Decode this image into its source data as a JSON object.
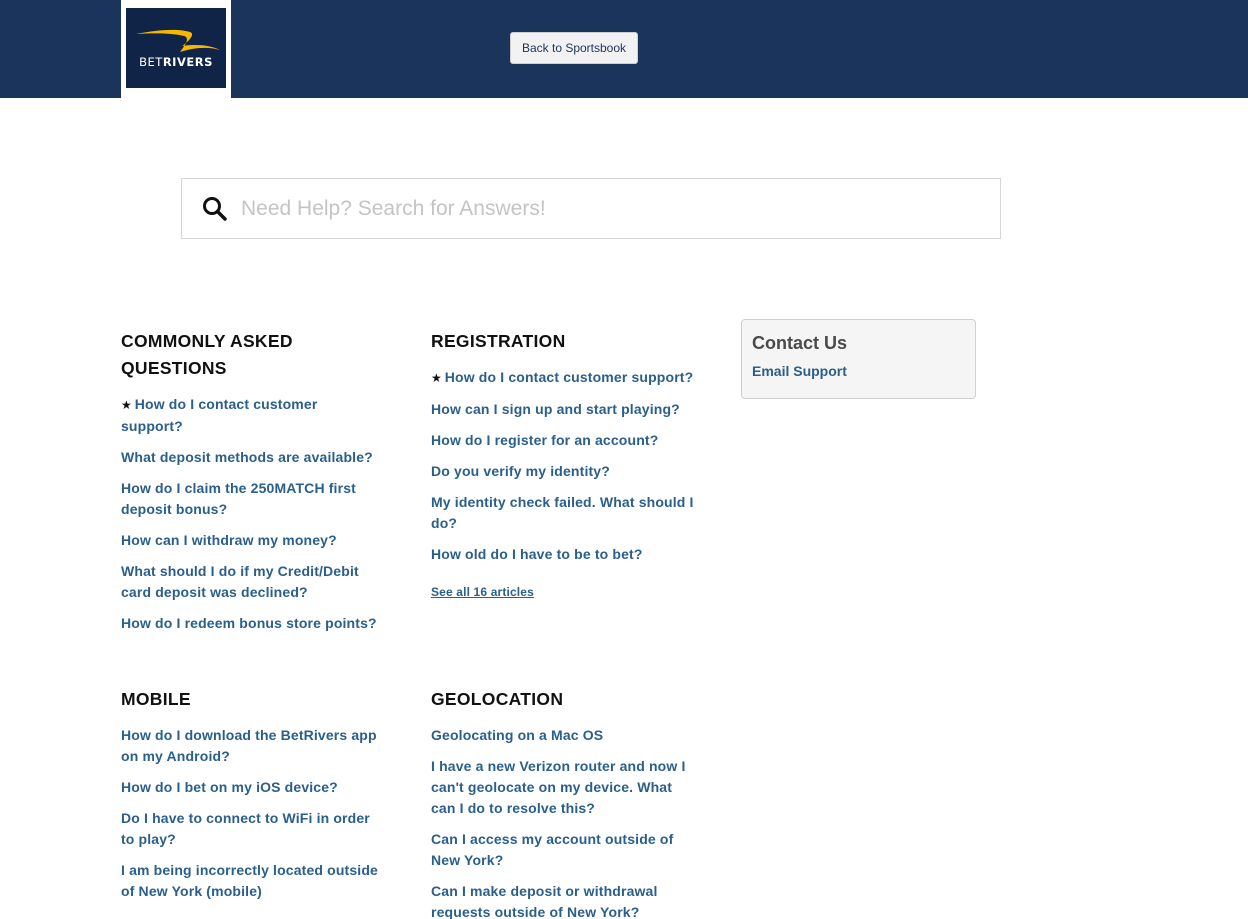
{
  "header": {
    "logo_prefix": "BET",
    "logo_suffix": "RIVERS",
    "back_button": "Back to Sportsbook"
  },
  "search": {
    "placeholder": "Need Help? Search for Answers!"
  },
  "sections": {
    "faq": {
      "title": "COMMONLY ASKED QUESTIONS",
      "items": [
        "How do I contact customer support?",
        "What deposit methods are available?",
        "How do I claim the 250MATCH first deposit bonus?",
        "How can I withdraw my money?",
        "What should I do if my Credit/Debit card deposit was declined?",
        "How do I redeem bonus store points?"
      ]
    },
    "registration": {
      "title": "REGISTRATION",
      "items": [
        "How do I contact customer support?",
        "How can I sign up and start playing?",
        "How do I register for an account?",
        "Do you verify my identity?",
        "My identity check failed. What should I do?",
        "How old do I have to be to bet?"
      ],
      "see_all": "See all 16 articles"
    },
    "mobile": {
      "title": "MOBILE",
      "items": [
        "How do I download the BetRivers app on my Android?",
        "How do I bet on my iOS device?",
        "Do I have to connect to WiFi in order to play?",
        "I am being incorrectly located outside of New York (mobile)"
      ]
    },
    "geolocation": {
      "title": "GEOLOCATION",
      "items": [
        "Geolocating on a Mac OS",
        "I have a new Verizon router and now I can't geolocate on my device. What can I do to resolve this?",
        "Can I access my account outside of New York?",
        "Can I make deposit or withdrawal requests outside of New York?"
      ]
    }
  },
  "contact": {
    "title": "Contact Us",
    "link": "Email Support"
  },
  "colors": {
    "header_bg": "#1a345c",
    "link": "#2a5f8c",
    "logo_swoosh": "#f5b800"
  },
  "icons": {
    "search": "search-icon",
    "promoted": "star-icon",
    "logo_swoosh": "swoosh-icon"
  }
}
